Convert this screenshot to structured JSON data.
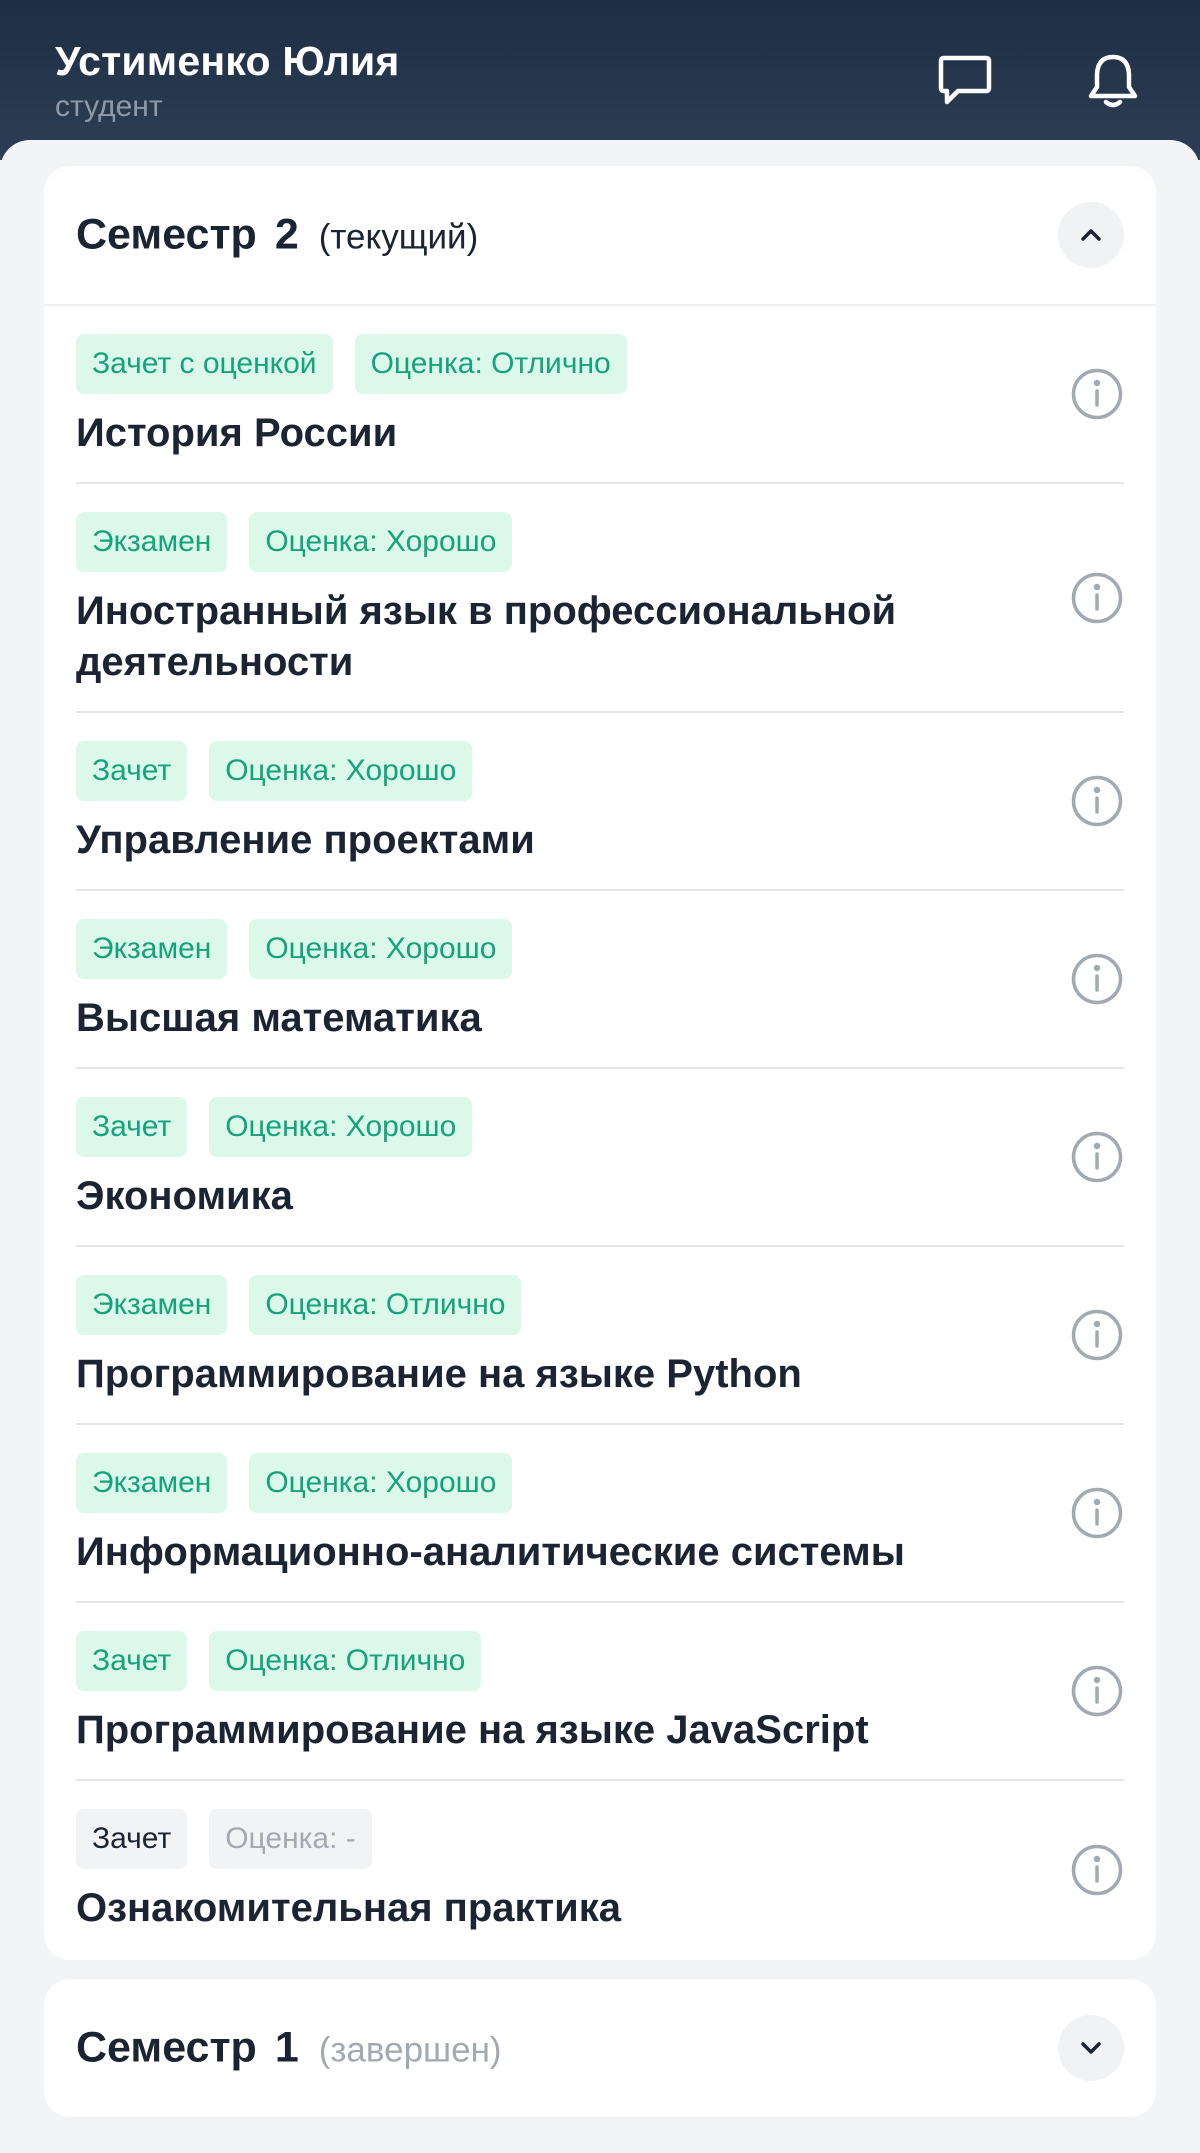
{
  "header": {
    "user_name": "Устименко Юлия",
    "user_role": "студент",
    "icons": [
      "chat-icon",
      "bell-icon"
    ]
  },
  "semesters": [
    {
      "label": "Семестр",
      "number": "2",
      "status": "(текущий)",
      "expanded": true,
      "subjects": [
        {
          "type": "Зачет с оценкой",
          "grade": "Оценка: Отлично",
          "name": "История России",
          "style": "green"
        },
        {
          "type": "Экзамен",
          "grade": "Оценка: Хорошо",
          "name": "Иностранный язык в профессиональной деятельности",
          "style": "green"
        },
        {
          "type": "Зачет",
          "grade": "Оценка: Хорошо",
          "name": "Управление проектами",
          "style": "green"
        },
        {
          "type": "Экзамен",
          "grade": "Оценка: Хорошо",
          "name": "Высшая математика",
          "style": "green"
        },
        {
          "type": "Зачет",
          "grade": "Оценка: Хорошо",
          "name": "Экономика",
          "style": "green"
        },
        {
          "type": "Экзамен",
          "grade": "Оценка: Отлично",
          "name": "Программирование на языке Python",
          "style": "green"
        },
        {
          "type": "Экзамен",
          "grade": "Оценка: Хорошо",
          "name": "Информационно-аналитические системы",
          "style": "green"
        },
        {
          "type": "Зачет",
          "grade": "Оценка: Отлично",
          "name": "Программирование на языке JavaScript",
          "style": "green"
        },
        {
          "type": "Зачет",
          "grade": "Оценка: -",
          "name": "Ознакомительная практика",
          "style": "grey"
        }
      ]
    },
    {
      "label": "Семестр",
      "number": "1",
      "status": "(завершен)",
      "expanded": false,
      "subjects": []
    }
  ],
  "colors": {
    "header_bg": "#1e2e44",
    "tag_green_bg": "#dcf8ea",
    "tag_green_text": "#14a37b",
    "tag_grey_bg": "#f2f3f5",
    "muted_text": "#a3a9b1",
    "primary_text": "#1c2434"
  }
}
